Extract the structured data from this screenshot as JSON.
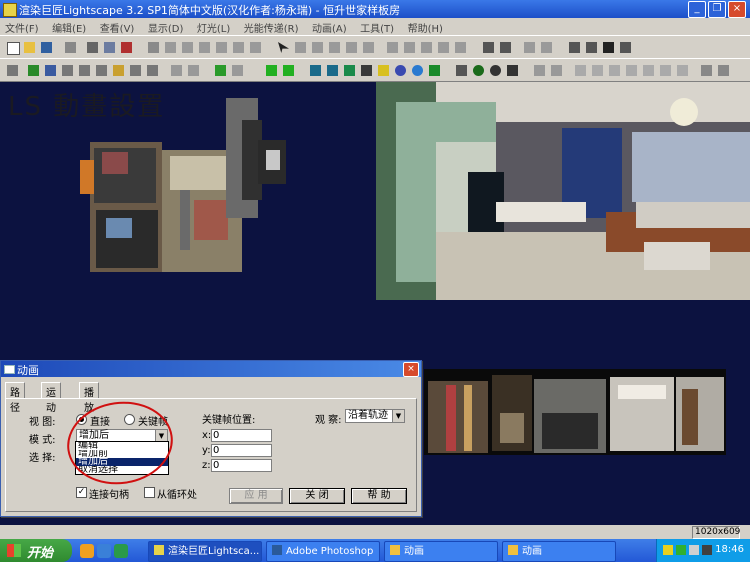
{
  "window": {
    "title": "渲染巨匠Lightscape 3.2 SP1简体中文版(汉化作者:杨永瑞) - 恒升世家样板房"
  },
  "menubar": {
    "items": [
      "文件(F)",
      "编辑(E)",
      "查看(V)",
      "显示(D)",
      "灯光(L)",
      "光能传递(R)",
      "动画(A)",
      "工具(T)",
      "帮助(H)"
    ]
  },
  "canvas": {
    "overlay_title": "LS 動畫設置"
  },
  "dialog": {
    "title": "动画",
    "close_label": "×",
    "tabs": [
      "路径",
      "运动",
      "播放"
    ],
    "view_label": "视 图:",
    "view_options": [
      "直接",
      "关键帧"
    ],
    "view_selected": "直接",
    "mode_label": "模 式:",
    "mode_value": "增加后",
    "mode_options": [
      "编辑",
      "增加前",
      "增加后",
      "取消选择"
    ],
    "mode_highlighted": "增加后",
    "select_label": "选 择:",
    "keyframe_pos_label": "关键帧位置:",
    "coords": [
      {
        "label": "x:",
        "value": "0"
      },
      {
        "label": "y:",
        "value": "0"
      },
      {
        "label": "z:",
        "value": "0"
      }
    ],
    "observe_label": "观 察:",
    "observe_value": "沿着轨迹",
    "checks": [
      {
        "label": "连接句柄",
        "checked": true
      },
      {
        "label": "从循环处",
        "checked": false
      }
    ],
    "buttons": {
      "apply": "应 用",
      "close": "关 闭",
      "help": "帮 助"
    }
  },
  "statusbar": {
    "resolution": "1020x609"
  },
  "taskbar": {
    "start_label": "开始",
    "tasks": [
      "渲染巨匠Lightsca...",
      "Adobe Photoshop",
      "动画",
      "动画"
    ],
    "clock": "18:46"
  },
  "colors": {
    "canvas_bg": "#0c1240",
    "dialog_bg": "#d4d0c8",
    "titlebar": "#1d49b8",
    "annotation": "#d01010"
  }
}
